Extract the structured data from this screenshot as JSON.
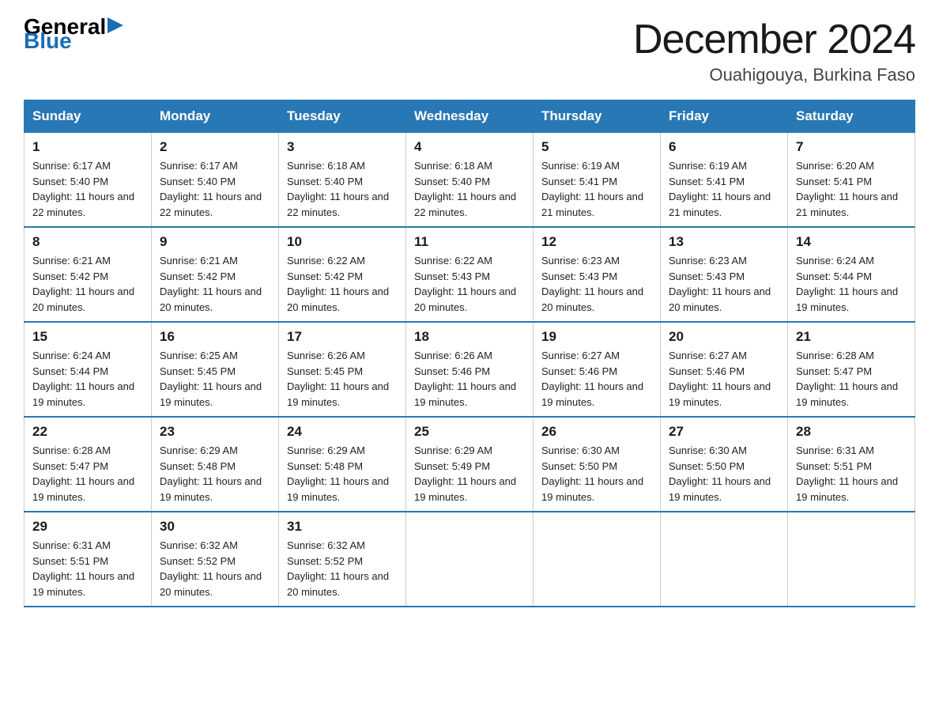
{
  "logo": {
    "general": "General",
    "blue": "Blue",
    "triangle": "▶"
  },
  "title": {
    "month": "December 2024",
    "location": "Ouahigouya, Burkina Faso"
  },
  "headers": [
    "Sunday",
    "Monday",
    "Tuesday",
    "Wednesday",
    "Thursday",
    "Friday",
    "Saturday"
  ],
  "weeks": [
    [
      {
        "day": "1",
        "sunrise": "6:17 AM",
        "sunset": "5:40 PM",
        "daylight": "11 hours and 22 minutes."
      },
      {
        "day": "2",
        "sunrise": "6:17 AM",
        "sunset": "5:40 PM",
        "daylight": "11 hours and 22 minutes."
      },
      {
        "day": "3",
        "sunrise": "6:18 AM",
        "sunset": "5:40 PM",
        "daylight": "11 hours and 22 minutes."
      },
      {
        "day": "4",
        "sunrise": "6:18 AM",
        "sunset": "5:40 PM",
        "daylight": "11 hours and 22 minutes."
      },
      {
        "day": "5",
        "sunrise": "6:19 AM",
        "sunset": "5:41 PM",
        "daylight": "11 hours and 21 minutes."
      },
      {
        "day": "6",
        "sunrise": "6:19 AM",
        "sunset": "5:41 PM",
        "daylight": "11 hours and 21 minutes."
      },
      {
        "day": "7",
        "sunrise": "6:20 AM",
        "sunset": "5:41 PM",
        "daylight": "11 hours and 21 minutes."
      }
    ],
    [
      {
        "day": "8",
        "sunrise": "6:21 AM",
        "sunset": "5:42 PM",
        "daylight": "11 hours and 20 minutes."
      },
      {
        "day": "9",
        "sunrise": "6:21 AM",
        "sunset": "5:42 PM",
        "daylight": "11 hours and 20 minutes."
      },
      {
        "day": "10",
        "sunrise": "6:22 AM",
        "sunset": "5:42 PM",
        "daylight": "11 hours and 20 minutes."
      },
      {
        "day": "11",
        "sunrise": "6:22 AM",
        "sunset": "5:43 PM",
        "daylight": "11 hours and 20 minutes."
      },
      {
        "day": "12",
        "sunrise": "6:23 AM",
        "sunset": "5:43 PM",
        "daylight": "11 hours and 20 minutes."
      },
      {
        "day": "13",
        "sunrise": "6:23 AM",
        "sunset": "5:43 PM",
        "daylight": "11 hours and 20 minutes."
      },
      {
        "day": "14",
        "sunrise": "6:24 AM",
        "sunset": "5:44 PM",
        "daylight": "11 hours and 19 minutes."
      }
    ],
    [
      {
        "day": "15",
        "sunrise": "6:24 AM",
        "sunset": "5:44 PM",
        "daylight": "11 hours and 19 minutes."
      },
      {
        "day": "16",
        "sunrise": "6:25 AM",
        "sunset": "5:45 PM",
        "daylight": "11 hours and 19 minutes."
      },
      {
        "day": "17",
        "sunrise": "6:26 AM",
        "sunset": "5:45 PM",
        "daylight": "11 hours and 19 minutes."
      },
      {
        "day": "18",
        "sunrise": "6:26 AM",
        "sunset": "5:46 PM",
        "daylight": "11 hours and 19 minutes."
      },
      {
        "day": "19",
        "sunrise": "6:27 AM",
        "sunset": "5:46 PM",
        "daylight": "11 hours and 19 minutes."
      },
      {
        "day": "20",
        "sunrise": "6:27 AM",
        "sunset": "5:46 PM",
        "daylight": "11 hours and 19 minutes."
      },
      {
        "day": "21",
        "sunrise": "6:28 AM",
        "sunset": "5:47 PM",
        "daylight": "11 hours and 19 minutes."
      }
    ],
    [
      {
        "day": "22",
        "sunrise": "6:28 AM",
        "sunset": "5:47 PM",
        "daylight": "11 hours and 19 minutes."
      },
      {
        "day": "23",
        "sunrise": "6:29 AM",
        "sunset": "5:48 PM",
        "daylight": "11 hours and 19 minutes."
      },
      {
        "day": "24",
        "sunrise": "6:29 AM",
        "sunset": "5:48 PM",
        "daylight": "11 hours and 19 minutes."
      },
      {
        "day": "25",
        "sunrise": "6:29 AM",
        "sunset": "5:49 PM",
        "daylight": "11 hours and 19 minutes."
      },
      {
        "day": "26",
        "sunrise": "6:30 AM",
        "sunset": "5:50 PM",
        "daylight": "11 hours and 19 minutes."
      },
      {
        "day": "27",
        "sunrise": "6:30 AM",
        "sunset": "5:50 PM",
        "daylight": "11 hours and 19 minutes."
      },
      {
        "day": "28",
        "sunrise": "6:31 AM",
        "sunset": "5:51 PM",
        "daylight": "11 hours and 19 minutes."
      }
    ],
    [
      {
        "day": "29",
        "sunrise": "6:31 AM",
        "sunset": "5:51 PM",
        "daylight": "11 hours and 19 minutes."
      },
      {
        "day": "30",
        "sunrise": "6:32 AM",
        "sunset": "5:52 PM",
        "daylight": "11 hours and 20 minutes."
      },
      {
        "day": "31",
        "sunrise": "6:32 AM",
        "sunset": "5:52 PM",
        "daylight": "11 hours and 20 minutes."
      },
      null,
      null,
      null,
      null
    ]
  ]
}
